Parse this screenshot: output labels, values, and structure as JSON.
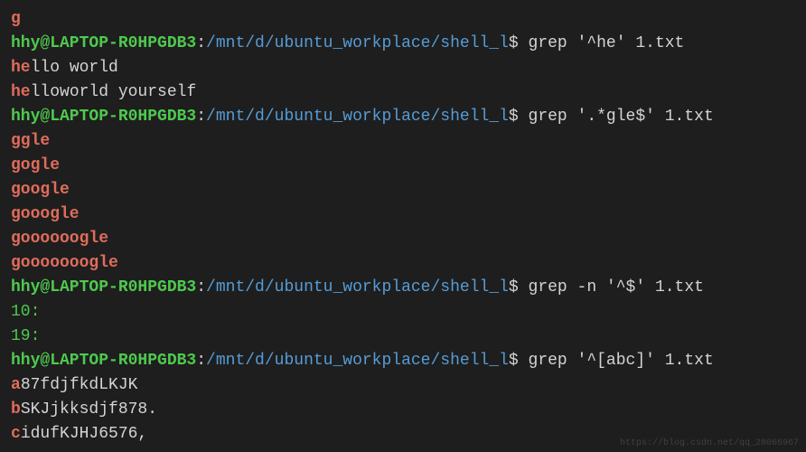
{
  "truncated_top": "g",
  "prompt": {
    "userhost": "hhy@LAPTOP-R0HPGDB3",
    "sep": ":",
    "path": "/mnt/d/ubuntu_workplace/shell_l",
    "dollar": "$ "
  },
  "blocks": [
    {
      "command": "grep '^he' 1.txt",
      "outputs": [
        {
          "match": "he",
          "rest": "llo world"
        },
        {
          "match": "he",
          "rest": "lloworld yourself"
        }
      ]
    },
    {
      "command": "grep '.*gle$' 1.txt",
      "outputs": [
        {
          "match": "ggle",
          "rest": ""
        },
        {
          "match": "gogle",
          "rest": ""
        },
        {
          "match": "google",
          "rest": ""
        },
        {
          "match": "gooogle",
          "rest": ""
        },
        {
          "match": "goooooogle",
          "rest": ""
        },
        {
          "match": "gooooooogle",
          "rest": ""
        }
      ]
    },
    {
      "command": "grep -n '^$' 1.txt",
      "outputs_numbered": [
        {
          "lineno": "10:"
        },
        {
          "lineno": "19:"
        }
      ]
    },
    {
      "command": "grep '^[abc]' 1.txt",
      "outputs": [
        {
          "match": "a",
          "rest": "87fdjfkdLKJK"
        },
        {
          "match": "b",
          "rest": "SKJjkksdjf878."
        },
        {
          "match": "c",
          "rest": "idufKJHJ6576,"
        }
      ]
    }
  ],
  "watermark": "https://blog.csdn.net/qq_28066967"
}
